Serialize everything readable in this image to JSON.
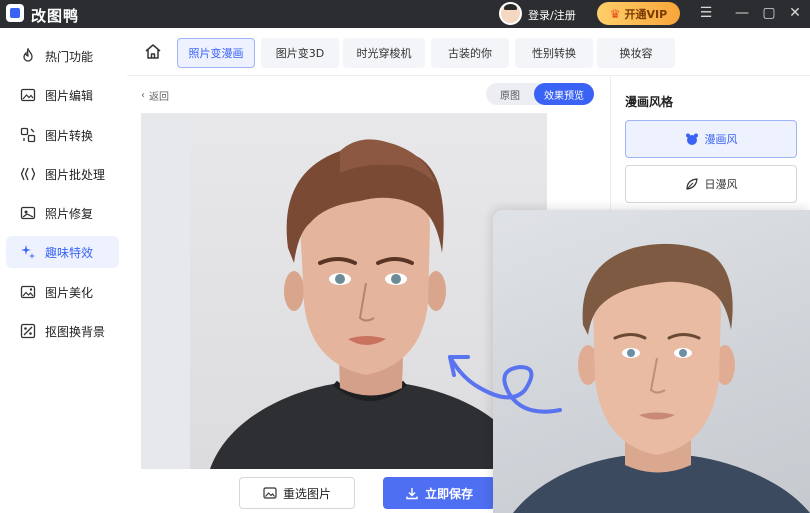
{
  "app": {
    "title": "改图鸭",
    "login_label": "登录/注册",
    "vip_label": "开通VIP"
  },
  "colors": {
    "accent": "#3a63f5",
    "titlebar_bg": "#2b2d31",
    "vip_gold": "#f8a53a"
  },
  "sidebar": {
    "items": [
      {
        "label": "热门功能",
        "icon": "fire-icon"
      },
      {
        "label": "图片编辑",
        "icon": "image-edit-icon"
      },
      {
        "label": "图片转换",
        "icon": "convert-icon"
      },
      {
        "label": "图片批处理",
        "icon": "batch-icon"
      },
      {
        "label": "照片修复",
        "icon": "photo-repair-icon"
      },
      {
        "label": "趣味特效",
        "icon": "sparkle-icon",
        "active": true
      },
      {
        "label": "图片美化",
        "icon": "beautify-icon"
      },
      {
        "label": "抠图换背景",
        "icon": "cutout-icon"
      }
    ]
  },
  "tabs": [
    {
      "label": "照片变漫画",
      "active": true
    },
    {
      "label": "图片变3D"
    },
    {
      "label": "时光穿梭机"
    },
    {
      "label": "古装的你"
    },
    {
      "label": "性别转换"
    },
    {
      "label": "换妆容"
    }
  ],
  "main": {
    "back_label": "返回",
    "toggle_original": "原图",
    "toggle_preview": "效果预览",
    "reselect_label": "重选图片",
    "save_label": "立即保存"
  },
  "style_panel": {
    "title": "漫画风格",
    "options": [
      {
        "label": "漫画风",
        "active": true,
        "icon": "bear-icon"
      },
      {
        "label": "日漫风",
        "icon": "leaf-icon"
      }
    ]
  }
}
